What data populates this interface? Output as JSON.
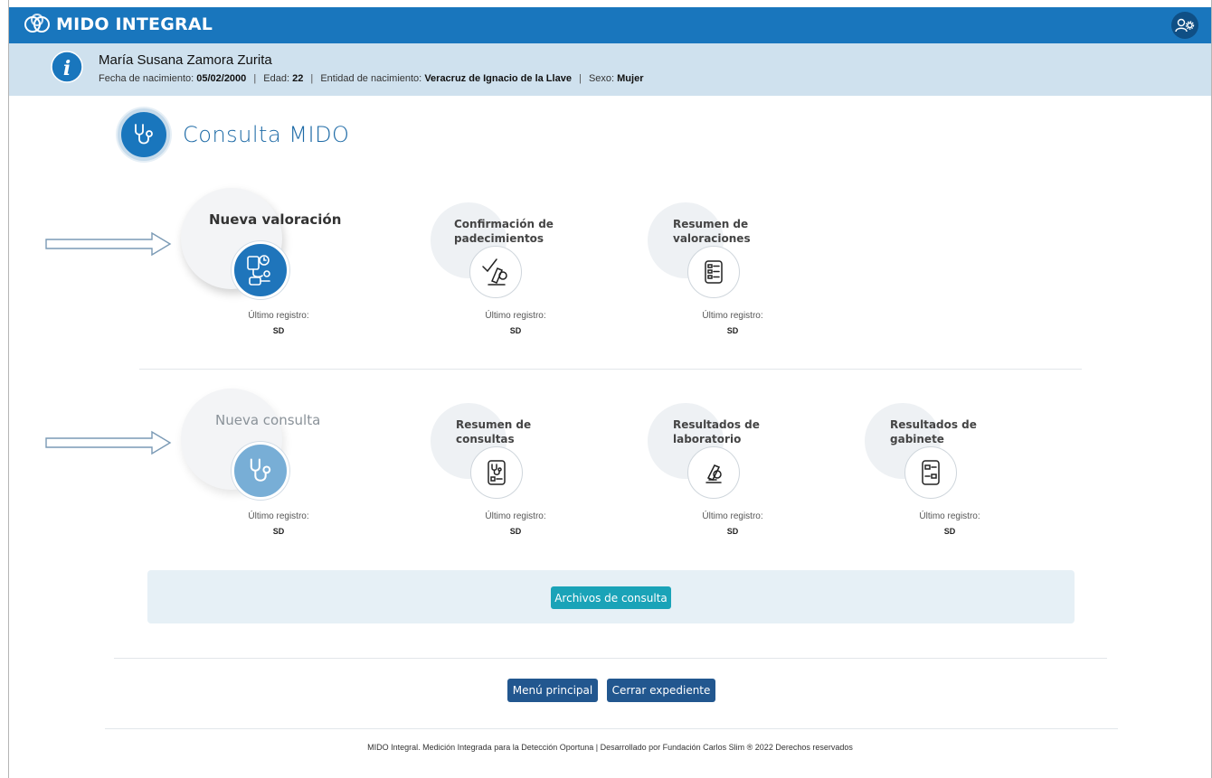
{
  "header": {
    "app_name": "MIDO INTEGRAL",
    "brand_color": "#1976bd"
  },
  "patient": {
    "name": "María Susana Zamora Zurita",
    "birth_label": "Fecha de nacimiento:",
    "birth_value": "05/02/2000",
    "age_label": "Edad:",
    "age_value": "22",
    "entity_label": "Entidad de nacimiento:",
    "entity_value": "Veracruz de Ignacio de la Llave",
    "sex_label": "Sexo:",
    "sex_value": "Mujer"
  },
  "page_title": "Consulta MIDO",
  "last_label": "Último registro:",
  "valoracion_cards": [
    {
      "title": "Nueva valoración",
      "icon": "blood-pressure-icon",
      "last": "SD"
    },
    {
      "title": "Confirmación de padecimientos",
      "icon": "check-microscope-icon",
      "last": "SD"
    },
    {
      "title": "Resumen de valoraciones",
      "icon": "list-document-icon",
      "last": "SD"
    }
  ],
  "consulta_cards": [
    {
      "title": "Nueva consulta",
      "icon": "stethoscope-icon",
      "last": "SD"
    },
    {
      "title": "Resumen de consultas",
      "icon": "stethoscope-document-icon",
      "last": "SD"
    },
    {
      "title": "Resultados de laboratorio",
      "icon": "microscope-icon",
      "last": "SD"
    },
    {
      "title": "Resultados de gabinete",
      "icon": "form-document-icon",
      "last": "SD"
    }
  ],
  "buttons": {
    "files": "Archivos de consulta",
    "main_menu": "Menú principal",
    "close_record": "Cerrar expediente"
  },
  "footer": "MIDO Integral. Medición Integrada para la Detección Oportuna | Desarrollado por Fundación Carlos Slim ® 2022 Derechos reservados"
}
